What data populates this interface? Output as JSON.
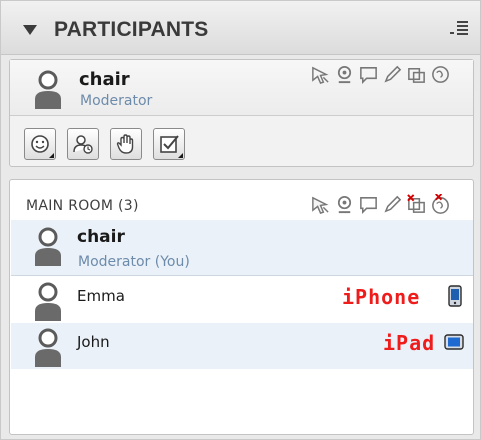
{
  "header": {
    "title": "PARTICIPANTS"
  },
  "self": {
    "name": "chair",
    "role": "Moderator"
  },
  "room": {
    "title": "MAIN ROOM (3)",
    "participants": [
      {
        "name": "chair",
        "role": "Moderator (You)",
        "bold": true,
        "device": ""
      },
      {
        "name": "Emma",
        "role": "",
        "bold": false,
        "device": "iPhone"
      },
      {
        "name": "John",
        "role": "",
        "bold": false,
        "device": "iPad"
      }
    ]
  },
  "colors": {
    "accent_blue": "#6d8bab",
    "device_red": "#ef1c1c",
    "row_highlight": "#eaf1f8"
  },
  "icons": {
    "header": [
      "collapse-arrow",
      "options-menu-icon"
    ],
    "permissions": [
      "pointer-permission-icon",
      "webcam-permission-icon",
      "chat-permission-icon",
      "pencil-permission-icon",
      "share-permission-icon",
      "globe-permission-icon"
    ],
    "toolbar": [
      "emoticon-status-icon",
      "user-options-icon",
      "raise-hand-icon",
      "checkbox-icon"
    ],
    "devices": [
      "iphone-device-icon",
      "ipad-device-icon"
    ]
  }
}
